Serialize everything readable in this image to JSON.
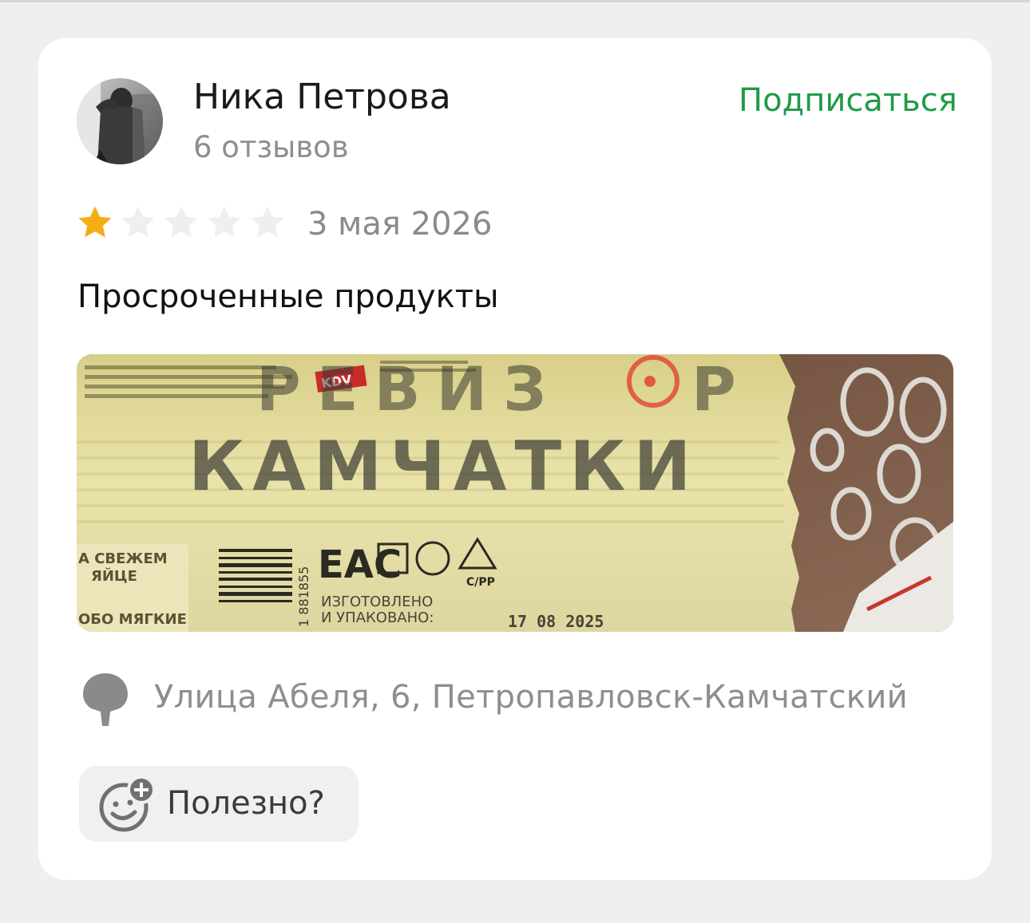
{
  "review": {
    "author": {
      "name": "Ника Петрова",
      "reviews_count": "6 отзывов"
    },
    "subscribe_label": "Подписаться",
    "rating": {
      "value": 1,
      "max": 5
    },
    "date": "3 мая 2026",
    "text": "Просроченные продукты",
    "photo": {
      "watermark_line1": "РЕВИЗ",
      "watermark_line1_end": "Р",
      "watermark_line2": "КАМЧАТКИ",
      "package_texts": {
        "brand": "KDV",
        "fresh_egg": "А СВЕЖЕМ",
        "egg": "ЯЙЦЕ",
        "soft": "ОБО МЯГКИЕ",
        "eac": "ЕАС",
        "made_line1": "ИЗГОТОВЛЕНО",
        "made_line2": "И УПАКОВАНО:",
        "date": "17 08 2025",
        "recycle": "C/PP",
        "barcode_digits": "1 881855"
      }
    },
    "location": "Улица Абеля, 6, Петропавловск-Камчатский",
    "useful_label": "Полезно?"
  },
  "colors": {
    "accent_green": "#1f9a47",
    "star_active": "#f4ae14",
    "star_inactive": "#efefef"
  }
}
